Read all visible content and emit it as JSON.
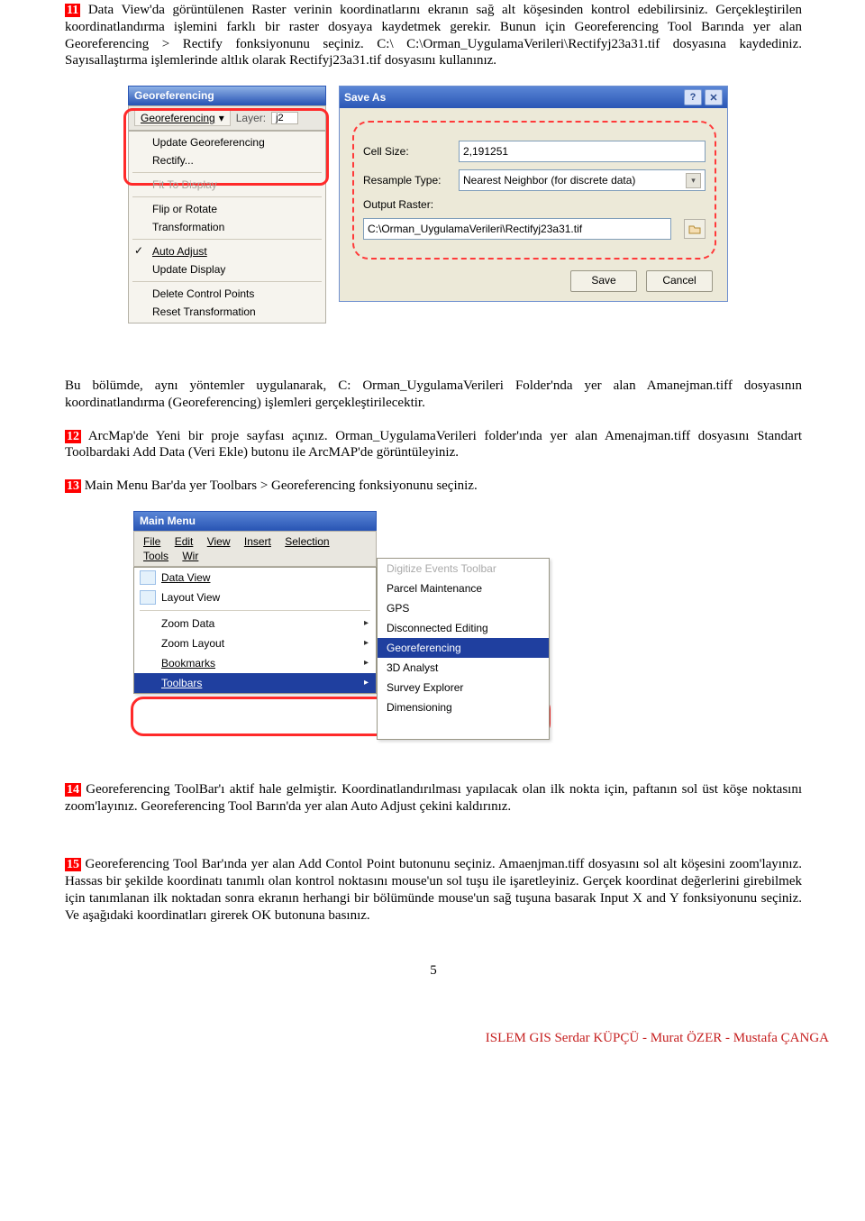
{
  "steps": {
    "s11": {
      "num": "11",
      "text": "Data View'da görüntülenen Raster verinin koordinatlarını ekranın sağ alt köşesinden kontrol edebilirsiniz. Gerçekleştirilen koordinatlandırma işlemini farklı bir raster dosyaya kaydetmek gerekir. Bunun için Georeferencing Tool Barında yer alan Georeferencing > Rectify fonksiyonunu seçiniz. C:\\ C:\\Orman_UygulamaVerileri\\Rectifyj23a31.tif dosyasına kaydediniz. Sayısallaştırma işlemlerinde altlık olarak Rectifyj23a31.tif dosyasını kullanınız."
    },
    "mid": "Bu bölümde, aynı yöntemler uygulanarak, C: Orman_UygulamaVerileri Folder'nda yer alan Amanejman.tiff dosyasının koordinatlandırma (Georeferencing) işlemleri gerçekleştirilecektir.",
    "s12": {
      "num": "12",
      "text": "ArcMap'de Yeni bir proje sayfası açınız. Orman_UygulamaVerileri  folder'ında yer alan Amenajman.tiff dosyasını Standart Toolbardaki Add Data (Veri Ekle) butonu ile ArcMAP'de görüntüleyiniz."
    },
    "s13": {
      "num": "13",
      "text": "Main Menu Bar'da yer Toolbars > Georeferencing fonksiyonunu seçiniz."
    },
    "s14": {
      "num": "14",
      "text": "Georeferencing ToolBar'ı aktif hale gelmiştir. Koordinatlandırılması yapılacak olan ilk nokta için, paftanın sol üst köşe noktasını zoom'layınız. Georeferencing Tool Barın'da yer alan Auto Adjust çekini kaldırınız."
    },
    "s15": {
      "num": "15",
      "text": "Georeferencing Tool Bar'ında yer alan Add Contol Point butonunu seçiniz. Amaenjman.tiff dosyasını sol alt köşesini zoom'layınız. Hassas bir şekilde koordinatı tanımlı olan kontrol noktasını mouse'un sol tuşu ile işaretleyiniz. Gerçek koordinat değerlerini girebilmek için tanımlanan ilk noktadan sonra ekranın herhangi bir bölümünde mouse'un sağ tuşuna basarak Input X and Y fonksiyonunu seçiniz. Ve aşağıdaki koordinatları girerek OK butonuna basınız."
    }
  },
  "geo_menu": {
    "title": "Georeferencing",
    "dropdown": "Georeferencing",
    "layer_label": "Layer:",
    "layer_value": "j2",
    "items": {
      "update": "Update Georeferencing",
      "rectify": "Rectify...",
      "fit": "Fit To Display",
      "flip": "Flip or Rotate",
      "transform": "Transformation",
      "auto": "Auto Adjust",
      "updisp": "Update Display",
      "delcp": "Delete Control Points",
      "reset": "Reset Transformation"
    },
    "check": "✓"
  },
  "saveas": {
    "title": "Save As",
    "help": "?",
    "close": "✕",
    "cellsize_label": "Cell Size:",
    "cellsize_value": "2,191251",
    "resample_label": "Resample Type:",
    "resample_value": "Nearest Neighbor (for discrete data)",
    "output_label": "Output Raster:",
    "output_value": "C:\\Orman_UygulamaVerileri\\Rectifyj23a31.tif",
    "save": "Save",
    "cancel": "Cancel"
  },
  "mainmenu": {
    "title": "Main Menu",
    "bar": {
      "file": "File",
      "edit": "Edit",
      "view": "View",
      "insert": "Insert",
      "selection": "Selection",
      "tools": "Tools",
      "wir": "Wir"
    },
    "left": {
      "data": "Data View",
      "layout": "Layout View",
      "zoomdata": "Zoom Data",
      "zoomlayout": "Zoom Layout",
      "bookmarks": "Bookmarks",
      "toolbars": "Toolbars"
    },
    "right": {
      "digitize": "Digitize Events Toolbar",
      "parcel": "Parcel Maintenance",
      "gps": "GPS",
      "disc": "Disconnected Editing",
      "geo": "Georeferencing",
      "analyst": "3D Analyst",
      "survey": "Survey Explorer",
      "dim": "Dimensioning"
    }
  },
  "page_number": "5",
  "footer": "ISLEM GIS  Serdar KÜPÇÜ - Murat ÖZER - Mustafa ÇANGA"
}
